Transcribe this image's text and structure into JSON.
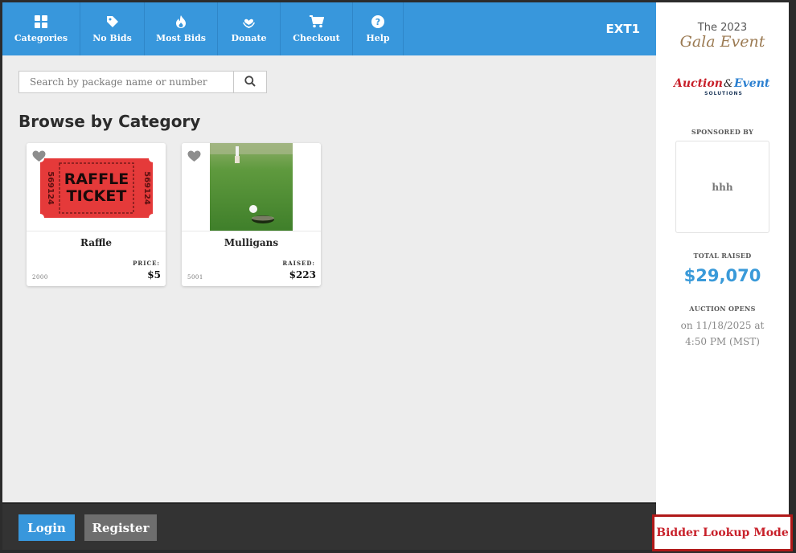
{
  "nav": {
    "items": [
      {
        "label": "Categories",
        "icon": "grid-icon"
      },
      {
        "label": "No Bids",
        "icon": "tag-icon"
      },
      {
        "label": "Most Bids",
        "icon": "flame-icon"
      },
      {
        "label": "Donate",
        "icon": "heart-hands-icon"
      },
      {
        "label": "Checkout",
        "icon": "cart-icon"
      },
      {
        "label": "Help",
        "icon": "question-icon"
      }
    ],
    "account_code": "EXT1"
  },
  "search": {
    "placeholder": "Search by package name or number",
    "value": ""
  },
  "main": {
    "heading": "Browse by Category",
    "cards": [
      {
        "title": "Raffle",
        "number": "2000",
        "price_label": "PRICE:",
        "price_value": "$5",
        "image": "raffle-ticket-image",
        "ticket_text_1": "RAFFLE",
        "ticket_text_2": "TICKET",
        "ticket_serial": "569124"
      },
      {
        "title": "Mulligans",
        "number": "5001",
        "price_label": "RAISED:",
        "price_value": "$223",
        "image": "golf-hole-image"
      }
    ]
  },
  "footer": {
    "login_label": "Login",
    "register_label": "Register"
  },
  "sidebar": {
    "event_year_line": "The 2023",
    "event_name": "Gala Event",
    "logo_text_1": "Auction",
    "logo_amp": "&",
    "logo_text_2": "Event",
    "logo_sub": "SOLUTIONS",
    "sponsored_label": "SPONSORED BY",
    "sponsor_name": "hhh",
    "total_label": "TOTAL RAISED",
    "total_value": "$29,070",
    "opens_label": "AUCTION OPENS",
    "opens_value": "on 11/18/2025 at 4:50 PM (MST)"
  },
  "bidder_lookup_label": "Bidder Lookup Mode",
  "colors": {
    "nav_blue": "#3897dc",
    "accent_red": "#c8202a",
    "total_blue": "#3a9ad9",
    "footer_dark": "#333333"
  }
}
